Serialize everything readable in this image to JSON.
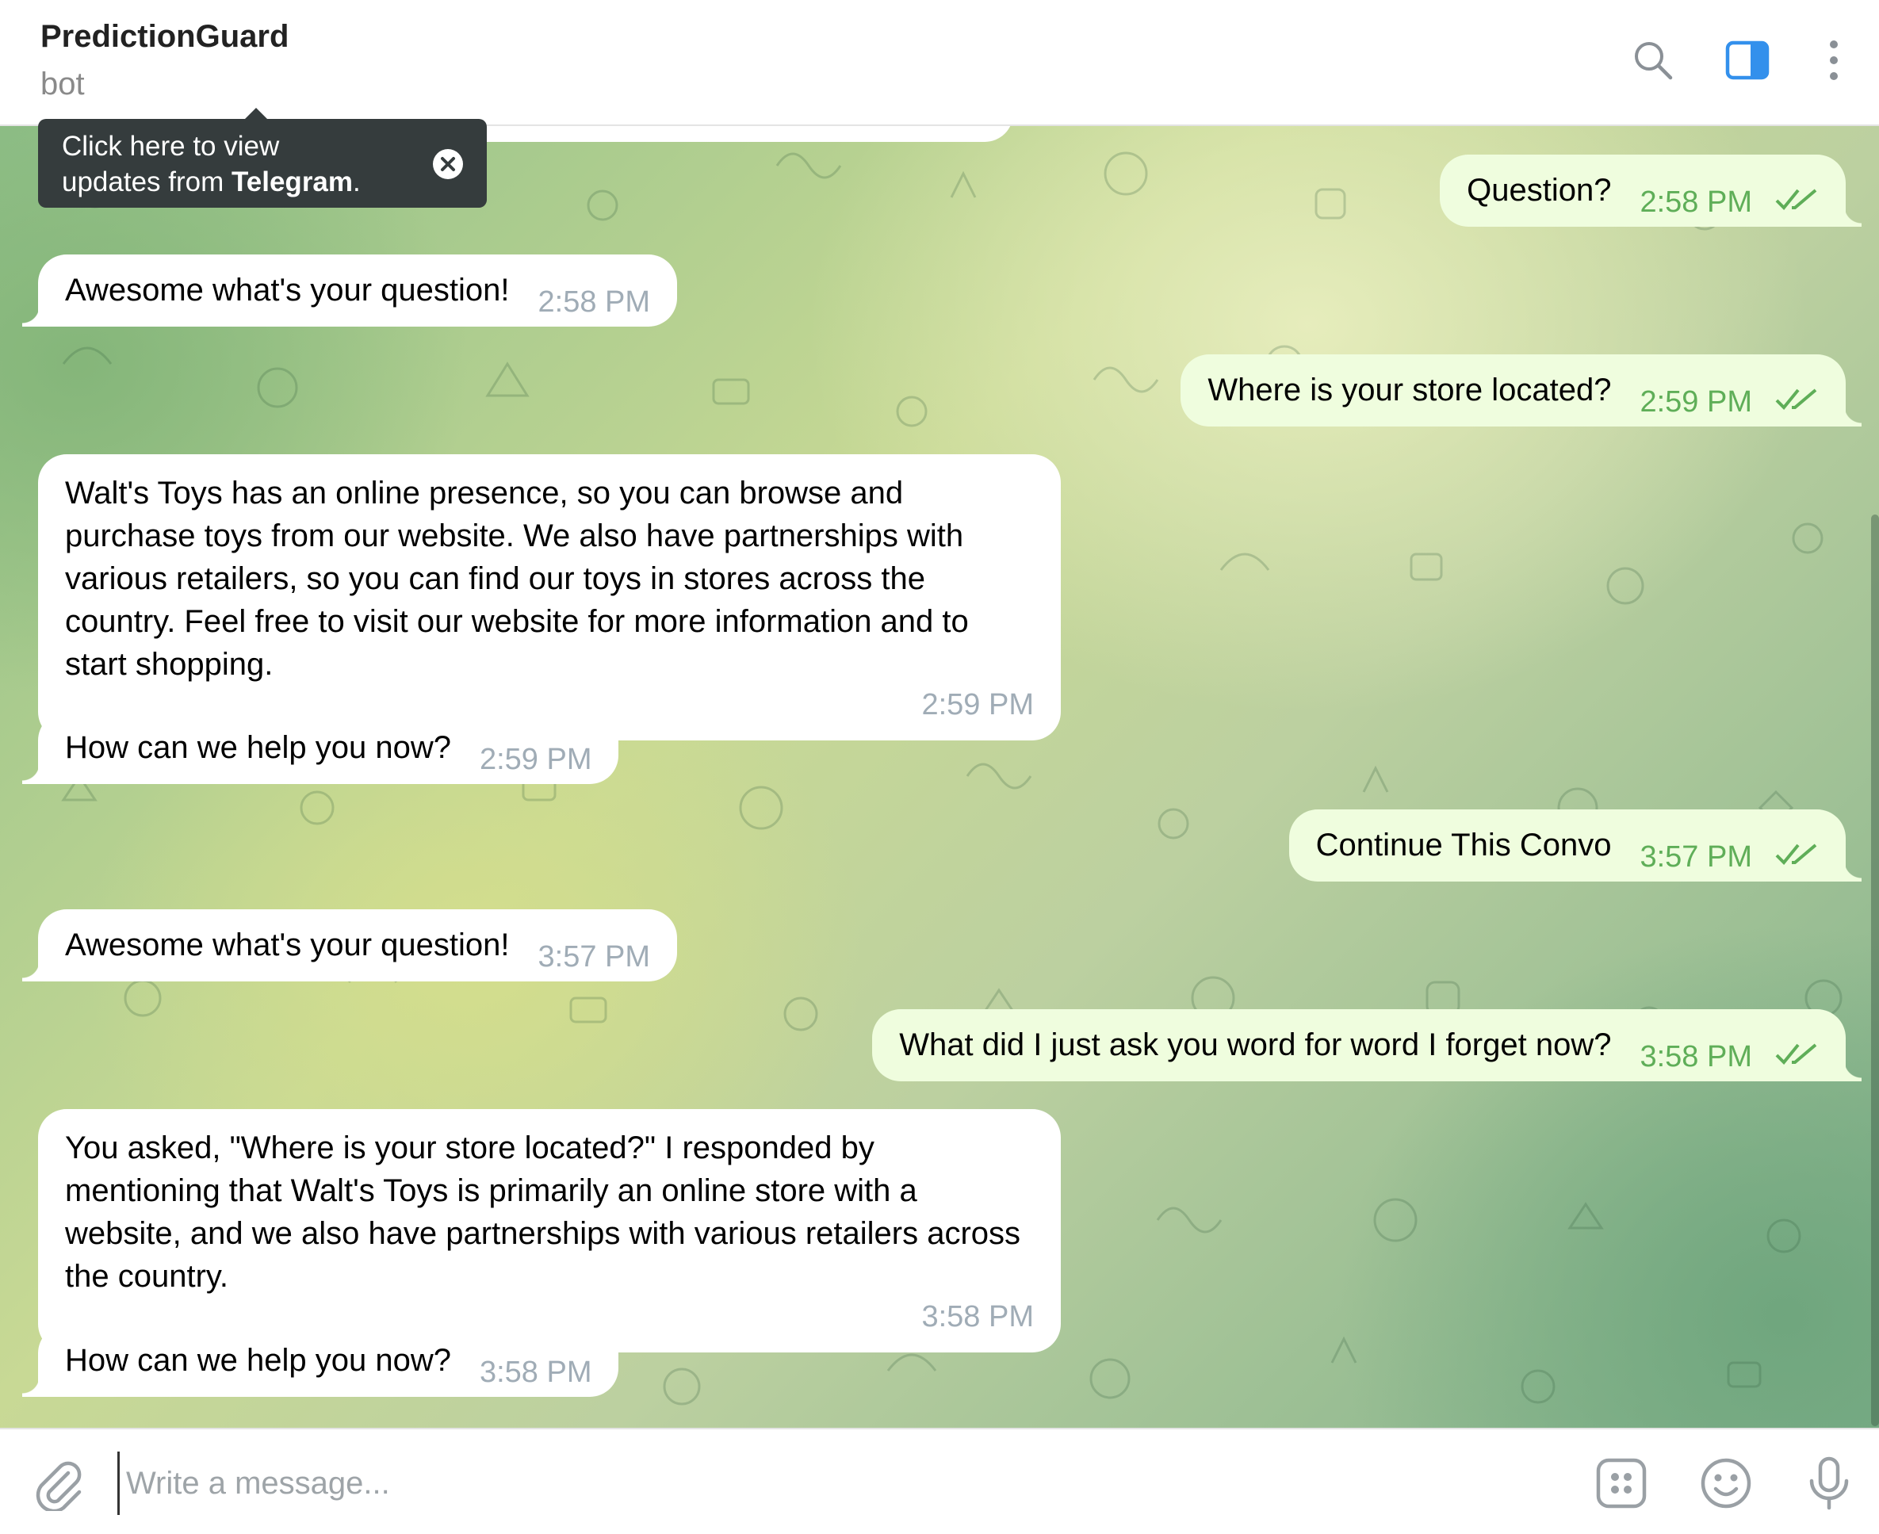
{
  "header": {
    "title": "PredictionGuard",
    "subtitle": "bot",
    "icons": [
      "search-icon",
      "sidebar-toggle-icon",
      "more-vertical-icon"
    ]
  },
  "tooltip": {
    "line1": "Click here to view",
    "line2_prefix": "updates from ",
    "line2_bold": "Telegram",
    "line2_suffix": "."
  },
  "messages": [
    {
      "dir": "out",
      "text": "Question?",
      "time": "2:58 PM",
      "read": true
    },
    {
      "dir": "in",
      "text": "Awesome what's your question!",
      "time": "2:58 PM"
    },
    {
      "dir": "out",
      "text": "Where is your store located?",
      "time": "2:59 PM",
      "read": true
    },
    {
      "dir": "in",
      "text": "Walt's Toys has an online presence, so you can browse and purchase toys from our website. We also have partnerships with various retailers, so you can find our toys in stores across the country. Feel free to visit our website for more information and to start shopping.",
      "time": "2:59 PM"
    },
    {
      "dir": "in",
      "text": "How can we help you now?",
      "time": "2:59 PM"
    },
    {
      "dir": "out",
      "text": "Continue This Convo",
      "time": "3:57 PM",
      "read": true
    },
    {
      "dir": "in",
      "text": "Awesome what's your question!",
      "time": "3:57 PM"
    },
    {
      "dir": "out",
      "text": "What did I just ask you word for word I forget now?",
      "time": "3:58 PM",
      "read": true
    },
    {
      "dir": "in",
      "text": "You asked, \"Where is your store located?\" I responded by mentioning that Walt's Toys is primarily an online store with a website, and we also have partnerships with various retailers across the country.",
      "time": "3:58 PM"
    },
    {
      "dir": "in",
      "text": "How can we help you now?",
      "time": "3:58 PM"
    }
  ],
  "composer": {
    "placeholder": "Write a message...",
    "icons": [
      "attach-icon",
      "bot-commands-icon",
      "emoji-icon",
      "microphone-icon"
    ]
  },
  "colors": {
    "incoming_bubble": "#ffffff",
    "outgoing_bubble": "#effdde",
    "outgoing_time": "#5fae58",
    "incoming_time": "#a0acb6",
    "accent": "#3390ec"
  }
}
